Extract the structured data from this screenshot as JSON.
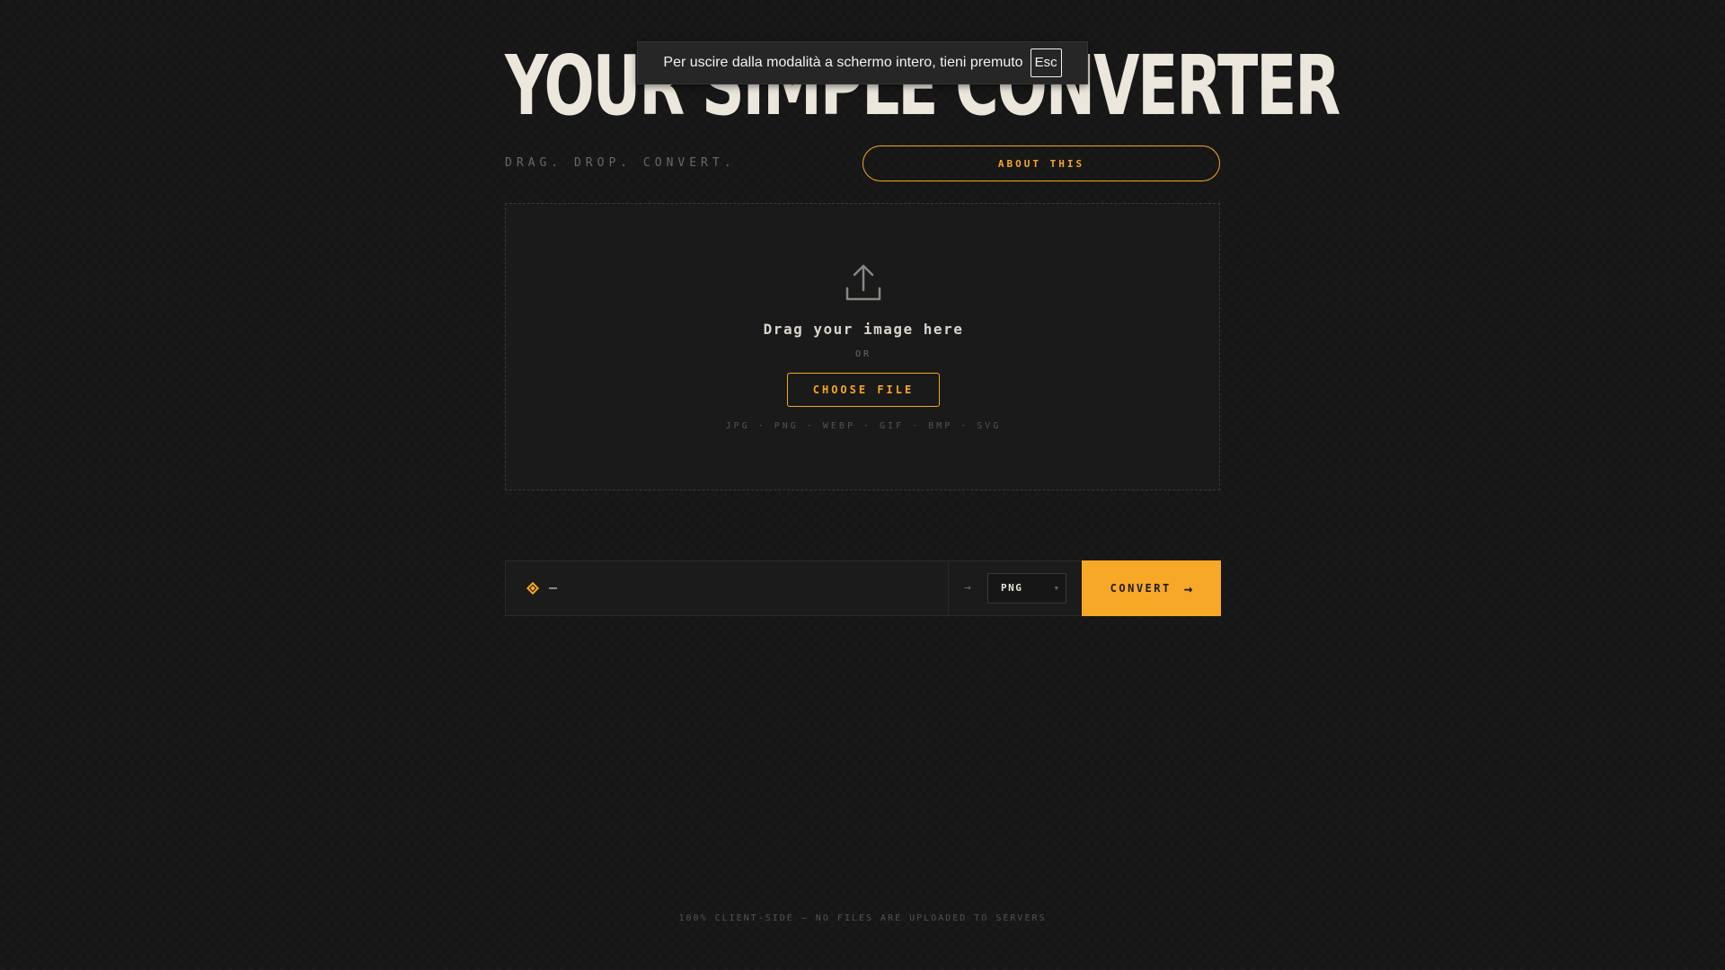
{
  "header": {
    "title": "YOUR SIMPLE CONVERTER",
    "tagline": "DRAG. DROP. CONVERT.",
    "about_label": "ABOUT THIS"
  },
  "dropzone": {
    "title": "Drag your image here",
    "or_text": "OR",
    "choose_label": "CHOOSE FILE",
    "formats": "JPG · PNG · WEBP · GIF · BMP · SVG"
  },
  "converter": {
    "file_name": "—",
    "format_selected": "PNG",
    "convert_label": "CONVERT"
  },
  "footer": {
    "note": "100% CLIENT-SIDE — NO FILES ARE UPLOADED TO SERVERS"
  },
  "fullscreen_toast": {
    "message": "Per uscire dalla modalità a schermo intero, tieni premuto",
    "key": "Esc"
  },
  "colors": {
    "accent": "#f5a623",
    "background": "#161616",
    "text": "#e8e4dc"
  }
}
